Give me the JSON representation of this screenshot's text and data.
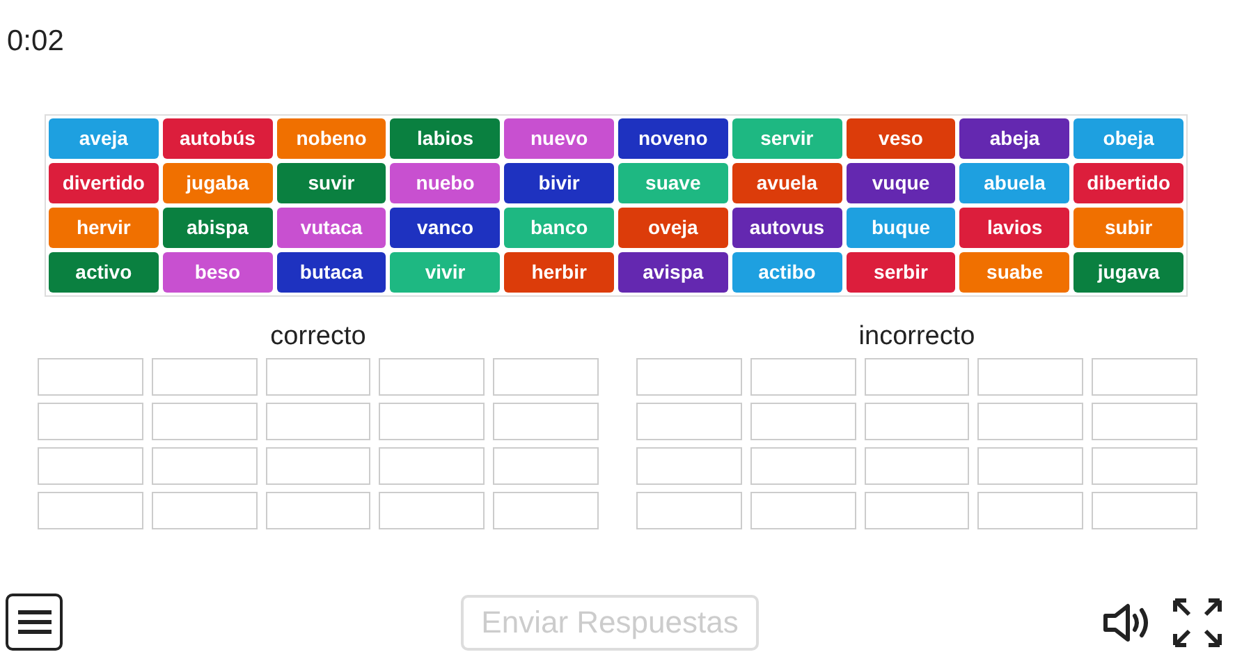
{
  "timer": "0:02",
  "tiles": [
    {
      "label": "aveja",
      "color": "#1ea0e0"
    },
    {
      "label": "autobús",
      "color": "#dc1e3c"
    },
    {
      "label": "nobeno",
      "color": "#f07000"
    },
    {
      "label": "labios",
      "color": "#0a8040"
    },
    {
      "label": "nuevo",
      "color": "#c850d0"
    },
    {
      "label": "noveno",
      "color": "#1e32c0"
    },
    {
      "label": "servir",
      "color": "#1eb882"
    },
    {
      "label": "veso",
      "color": "#dc3c0a"
    },
    {
      "label": "abeja",
      "color": "#6428b0"
    },
    {
      "label": "obeja",
      "color": "#1ea0e0"
    },
    {
      "label": "divertido",
      "color": "#dc1e3c"
    },
    {
      "label": "jugaba",
      "color": "#f07000"
    },
    {
      "label": "suvir",
      "color": "#0a8040"
    },
    {
      "label": "nuebo",
      "color": "#c850d0"
    },
    {
      "label": "bivir",
      "color": "#1e32c0"
    },
    {
      "label": "suave",
      "color": "#1eb882"
    },
    {
      "label": "avuela",
      "color": "#dc3c0a"
    },
    {
      "label": "vuque",
      "color": "#6428b0"
    },
    {
      "label": "abuela",
      "color": "#1ea0e0"
    },
    {
      "label": "dibertido",
      "color": "#dc1e3c"
    },
    {
      "label": "hervir",
      "color": "#f07000"
    },
    {
      "label": "abispa",
      "color": "#0a8040"
    },
    {
      "label": "vutaca",
      "color": "#c850d0"
    },
    {
      "label": "vanco",
      "color": "#1e32c0"
    },
    {
      "label": "banco",
      "color": "#1eb882"
    },
    {
      "label": "oveja",
      "color": "#dc3c0a"
    },
    {
      "label": "autovus",
      "color": "#6428b0"
    },
    {
      "label": "buque",
      "color": "#1ea0e0"
    },
    {
      "label": "lavios",
      "color": "#dc1e3c"
    },
    {
      "label": "subir",
      "color": "#f07000"
    },
    {
      "label": "activo",
      "color": "#0a8040"
    },
    {
      "label": "beso",
      "color": "#c850d0"
    },
    {
      "label": "butaca",
      "color": "#1e32c0"
    },
    {
      "label": "vivir",
      "color": "#1eb882"
    },
    {
      "label": "herbir",
      "color": "#dc3c0a"
    },
    {
      "label": "avispa",
      "color": "#6428b0"
    },
    {
      "label": "actibo",
      "color": "#1ea0e0"
    },
    {
      "label": "serbir",
      "color": "#dc1e3c"
    },
    {
      "label": "suabe",
      "color": "#f07000"
    },
    {
      "label": "jugava",
      "color": "#0a8040"
    }
  ],
  "groups": [
    {
      "title": "correcto"
    },
    {
      "title": "incorrecto"
    }
  ],
  "submit_button": {
    "label": "Enviar Respuestas",
    "disabled": true
  }
}
